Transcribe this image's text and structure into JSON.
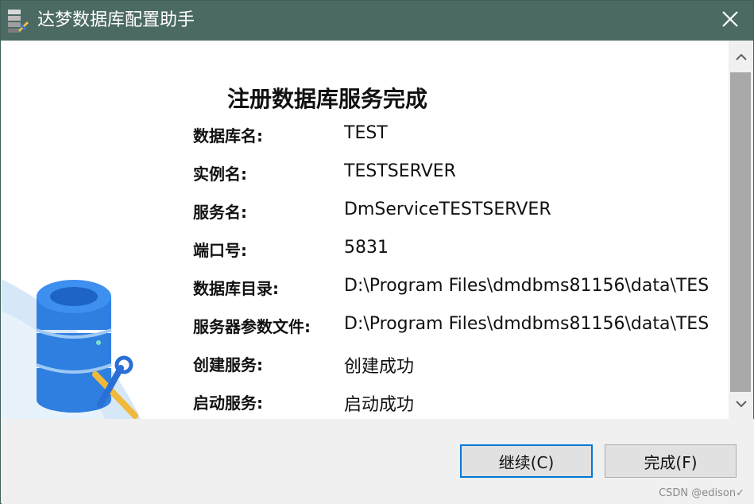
{
  "window": {
    "title": "达梦数据库配置助手",
    "icon": "database-config-app-icon",
    "close_icon": "close-icon"
  },
  "main": {
    "heading": "注册数据库服务完成",
    "rows": [
      {
        "label": "数据库名:",
        "value": "TEST"
      },
      {
        "label": "实例名:",
        "value": "TESTSERVER"
      },
      {
        "label": "服务名:",
        "value": "DmServiceTESTSERVER"
      },
      {
        "label": "端口号:",
        "value": "5831"
      },
      {
        "label": "数据库目录:",
        "value": "D:\\Program Files\\dmdbms81156\\data\\TES"
      },
      {
        "label": "服务器参数文件:",
        "value": "D:\\Program Files\\dmdbms81156\\data\\TES"
      },
      {
        "label": "创建服务:",
        "value": "创建成功"
      },
      {
        "label": "启动服务:",
        "value": "启动成功"
      }
    ]
  },
  "buttons": {
    "continue_label": "继续(C)",
    "finish_label": "完成(F)"
  },
  "watermark": "CSDN @edison✓",
  "colors": {
    "titlebar": "#4c6a64",
    "db_blue": "#2f7fe0",
    "focus_border": "#0078d7"
  }
}
